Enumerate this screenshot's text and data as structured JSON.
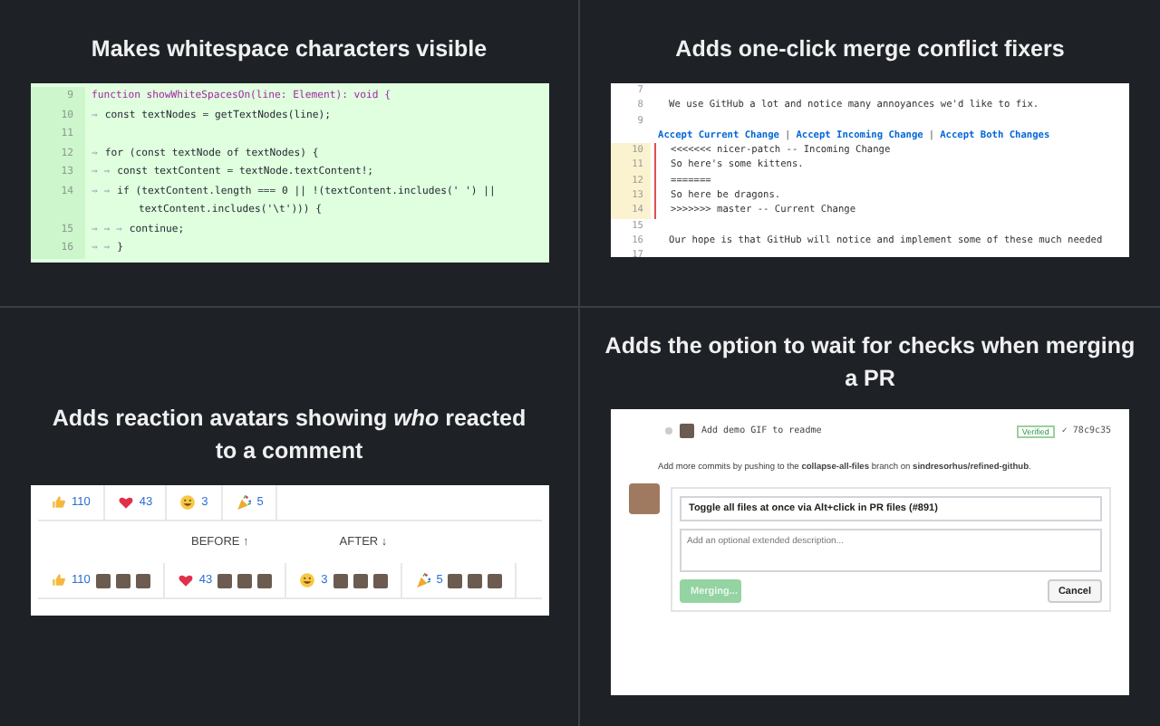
{
  "features": [
    {
      "kind": "code",
      "title": "Makes whitespace characters visible",
      "lines": [
        {
          "number": "9",
          "text": "function showWhiteSpacesOn(line: Element): void {"
        },
        {
          "number": "10",
          "markers": "→",
          "text": "const textNodes = getTextNodes(line);"
        },
        {
          "number": "11"
        },
        {
          "number": "12",
          "markers": "→",
          "text": "for (const textNode of textNodes) {"
        },
        {
          "number": "13",
          "markers": "→ →",
          "text": "const textContent = textNode.textContent!;"
        },
        {
          "number": "14",
          "markers": "→ →",
          "text": "if (textContent.length === 0 || !(textContent.includes(' ') ||",
          "continuation": "textContent.includes('\\t'))) {"
        },
        {
          "number": "15",
          "markers": "→ → →",
          "text": "continue;"
        },
        {
          "number": "16",
          "markers": "→ →",
          "text": "}"
        }
      ]
    },
    {
      "kind": "conflict",
      "title": "Adds one-click merge conflict fixers",
      "lines": [
        {
          "number": "7",
          "conflict": false
        },
        {
          "number": "8",
          "text": "We use GitHub a lot and notice many annoyances we'd like to fix.",
          "conflict": false
        },
        {
          "number": "9",
          "conflict": false,
          "actions": [
            "Accept Current Change",
            "Accept Incoming Change",
            "Accept Both Changes"
          ],
          "separators": [
            "|",
            "|"
          ]
        },
        {
          "number": "10",
          "text": "<<<<<<< nicer-patch -- Incoming Change",
          "conflict": true
        },
        {
          "number": "11",
          "text": "So here's some kittens.",
          "conflict": true
        },
        {
          "number": "12",
          "text": "=======",
          "conflict": true
        },
        {
          "number": "13",
          "text": "So here be dragons.",
          "conflict": true
        },
        {
          "number": "14",
          "text": ">>>>>>> master -- Current Change",
          "conflict": true
        },
        {
          "number": "15",
          "conflict": false
        },
        {
          "number": "16",
          "text": "Our hope is that GitHub will notice and implement some of these much needed",
          "conflict": false
        },
        {
          "number": "17",
          "conflict": false
        }
      ]
    },
    {
      "kind": "reactions",
      "title": "Adds reaction avatars showing *who* reacted to a comment",
      "reactions": [
        {
          "kind": "thumbs-up",
          "count": "110"
        },
        {
          "kind": "heart",
          "count": "43"
        },
        {
          "kind": "smile",
          "count": "3"
        },
        {
          "kind": "party",
          "count": "5"
        }
      ],
      "labels": [
        "BEFORE ↑",
        "AFTER ↓"
      ],
      "avatar_reactions": [
        {
          "kind": "thumbs-up",
          "count": "110"
        },
        {
          "kind": "heart",
          "count": "43"
        },
        {
          "kind": "smile",
          "count": "3"
        },
        {
          "kind": "party",
          "count": "5"
        }
      ]
    },
    {
      "kind": "merge",
      "title": "Adds the option to wait for checks when merging a PR",
      "commit": {
        "message": "Add demo GIF to readme",
        "badge": "Verified",
        "sha": "✓ 78c9c35"
      },
      "info": "Add more commits by pushing to the **collapse-all-files** branch on **sindresorhus/refined-github**.",
      "commit_title": "Toggle all files at once via Alt+click in PR files (#891)",
      "description": {
        "placeholder": "Add an optional extended description..."
      },
      "buttons": [
        {
          "label": "Merging...",
          "disabled": true
        },
        {
          "label": "Cancel",
          "disabled": false
        }
      ]
    }
  ]
}
